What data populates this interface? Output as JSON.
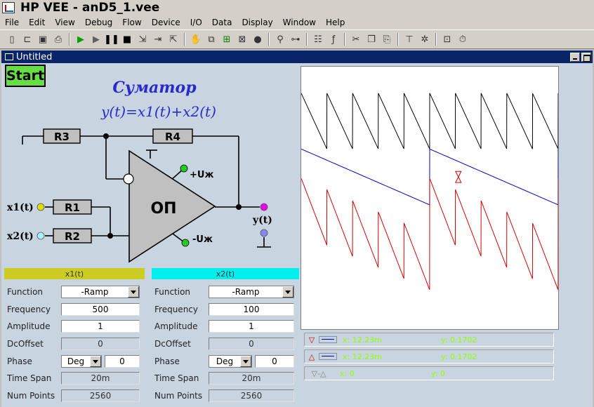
{
  "app": {
    "title": "HP VEE - anD5_1.vee"
  },
  "menu": [
    "File",
    "Edit",
    "View",
    "Debug",
    "Flow",
    "Device",
    "I/O",
    "Data",
    "Display",
    "Window",
    "Help"
  ],
  "window": {
    "title": "Untitled"
  },
  "start_label": "Start",
  "schematic": {
    "title": "Суматор",
    "formula": "y(t)=x1(t)+x2(t)",
    "r3": "R3",
    "r4": "R4",
    "r1": "R1",
    "r2": "R2",
    "opamp": "ОП",
    "vplus": "+Uж",
    "vminus": "-Uж",
    "x1": "x1(t)",
    "x2": "x2(t)",
    "y": "y(t)"
  },
  "x1": {
    "header": "x1(t)",
    "header_color": "#cccc22",
    "labels": {
      "function": "Function",
      "frequency": "Frequency",
      "amplitude": "Amplitude",
      "dcoffset": "DcOffset",
      "phase": "Phase",
      "timespan": "Time Span",
      "numpoints": "Num Points"
    },
    "function": "-Ramp",
    "frequency": "500",
    "amplitude": "1",
    "dcoffset": "0",
    "phase_unit": "Deg",
    "phase": "0",
    "timespan": "20m",
    "numpoints": "2560"
  },
  "x2": {
    "header": "x2(t)",
    "header_color": "#00eeee",
    "labels": {
      "function": "Function",
      "frequency": "Frequency",
      "amplitude": "Amplitude",
      "dcoffset": "DcOffset",
      "phase": "Phase",
      "timespan": "Time Span",
      "numpoints": "Num Points"
    },
    "function": "-Ramp",
    "frequency": "100",
    "amplitude": "1",
    "dcoffset": "0",
    "phase_unit": "Deg",
    "phase": "0",
    "timespan": "20m",
    "numpoints": "2560"
  },
  "markers": [
    {
      "symbol": "▽",
      "color": "#cc0000",
      "x": "x: 12.23m",
      "y": "y: 0.1702"
    },
    {
      "symbol": "△",
      "color": "#cc0000",
      "x": "x: 12.23m",
      "y": "y: 0.1702"
    },
    {
      "symbol": "▽-△",
      "color": "#808080",
      "x": "x: 0",
      "y": "y: 0"
    }
  ],
  "chart_data": {
    "type": "line",
    "series": [
      {
        "color": "#000000",
        "period": 0.002,
        "amplitude": 1,
        "shape": "-Ramp"
      },
      {
        "color": "#0000c0",
        "period": 0.01,
        "amplitude": 1,
        "shape": "-Ramp"
      },
      {
        "color": "#d00000",
        "shape": "sum"
      }
    ],
    "xlim": [
      0,
      0.02
    ]
  }
}
